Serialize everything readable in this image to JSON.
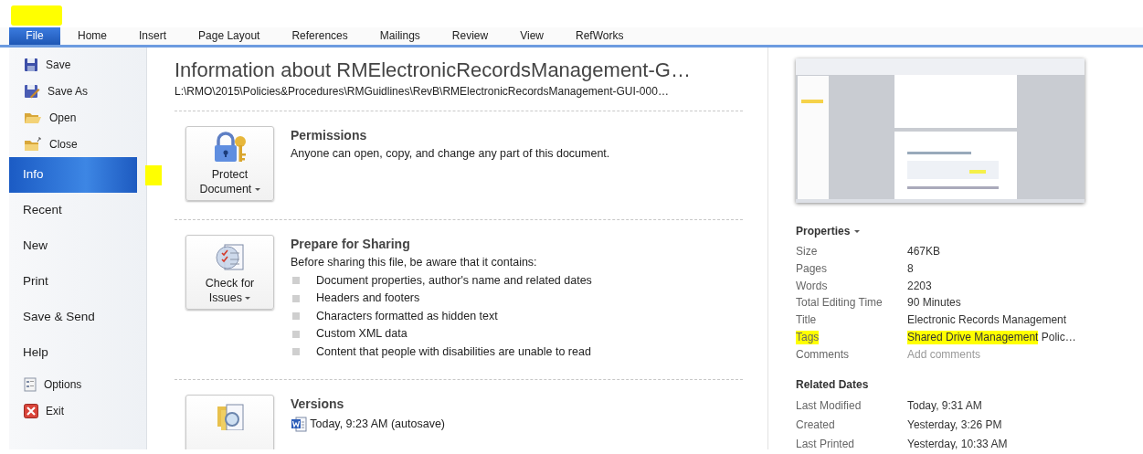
{
  "ribbon_tabs": [
    {
      "label": "File",
      "selected": true
    },
    {
      "label": "Home",
      "selected": false
    },
    {
      "label": "Insert",
      "selected": false
    },
    {
      "label": "Page Layout",
      "selected": false
    },
    {
      "label": "References",
      "selected": false
    },
    {
      "label": "Mailings",
      "selected": false
    },
    {
      "label": "Review",
      "selected": false
    },
    {
      "label": "View",
      "selected": false
    },
    {
      "label": "RefWorks",
      "selected": false
    }
  ],
  "sidebar": {
    "items": [
      {
        "label": "Save",
        "kind": "command",
        "selected": false
      },
      {
        "label": "Save As",
        "kind": "command",
        "selected": false
      },
      {
        "label": "Open",
        "kind": "command",
        "selected": false
      },
      {
        "label": "Close",
        "kind": "command",
        "selected": false
      },
      {
        "label": "Info",
        "kind": "page",
        "selected": true,
        "annotated": true
      },
      {
        "label": "Recent",
        "kind": "page",
        "selected": false
      },
      {
        "label": "New",
        "kind": "page",
        "selected": false
      },
      {
        "label": "Print",
        "kind": "page",
        "selected": false
      },
      {
        "label": "Save & Send",
        "kind": "page",
        "selected": false
      },
      {
        "label": "Help",
        "kind": "page",
        "selected": false
      },
      {
        "label": "Options",
        "kind": "command",
        "selected": false
      },
      {
        "label": "Exit",
        "kind": "command",
        "selected": false
      }
    ]
  },
  "info": {
    "title": "Information about RMElectronicRecordsManagement-G…",
    "path": "L:\\RMO\\2015\\Policies&Procedures\\RMGuidlines\\RevB\\RMElectronicRecordsManagement-GUI-000…",
    "sections": [
      {
        "button": {
          "lines": [
            "Protect",
            "Document"
          ]
        },
        "title": "Permissions",
        "description": "Anyone can open, copy, and change any part of this document."
      },
      {
        "button": {
          "lines": [
            "Check for",
            "Issues"
          ]
        },
        "title": "Prepare for Sharing",
        "description": "Before sharing this file, be aware that it contains:",
        "bullets": [
          "Document properties, author's name and related dates",
          "Headers and footers",
          "Characters formatted as hidden text",
          "Custom XML data",
          "Content that people with disabilities are unable to read"
        ]
      },
      {
        "title": "Versions",
        "versions": [
          "Today, 9:23 AM (autosave)"
        ]
      }
    ]
  },
  "properties": {
    "heading": "Properties",
    "rows": [
      {
        "label": "Size",
        "value": [
          {
            "text": "467KB"
          }
        ]
      },
      {
        "label": "Pages",
        "value": [
          {
            "text": "8"
          }
        ]
      },
      {
        "label": "Words",
        "value": [
          {
            "text": "2203"
          }
        ]
      },
      {
        "label": "Total Editing Time",
        "value": [
          {
            "text": "90 Minutes"
          }
        ]
      },
      {
        "label": "Title",
        "value": [
          {
            "text": "Electronic Records Management"
          }
        ]
      },
      {
        "label": "Tags",
        "highlighted": true,
        "value": [
          {
            "text": "Shared Drive Management",
            "highlighted": true
          },
          {
            "text": " Polic…"
          }
        ]
      },
      {
        "label": "Comments",
        "placeholder": "Add comments"
      }
    ]
  },
  "related_dates": {
    "heading": "Related Dates",
    "rows": [
      {
        "label": "Last Modified",
        "value": "Today, 9:31 AM"
      },
      {
        "label": "Created",
        "value": "Yesterday, 3:26 PM"
      },
      {
        "label": "Last Printed",
        "value": "Yesterday, 10:33 AM"
      }
    ]
  },
  "annotations": {
    "corner_highlight": true
  }
}
